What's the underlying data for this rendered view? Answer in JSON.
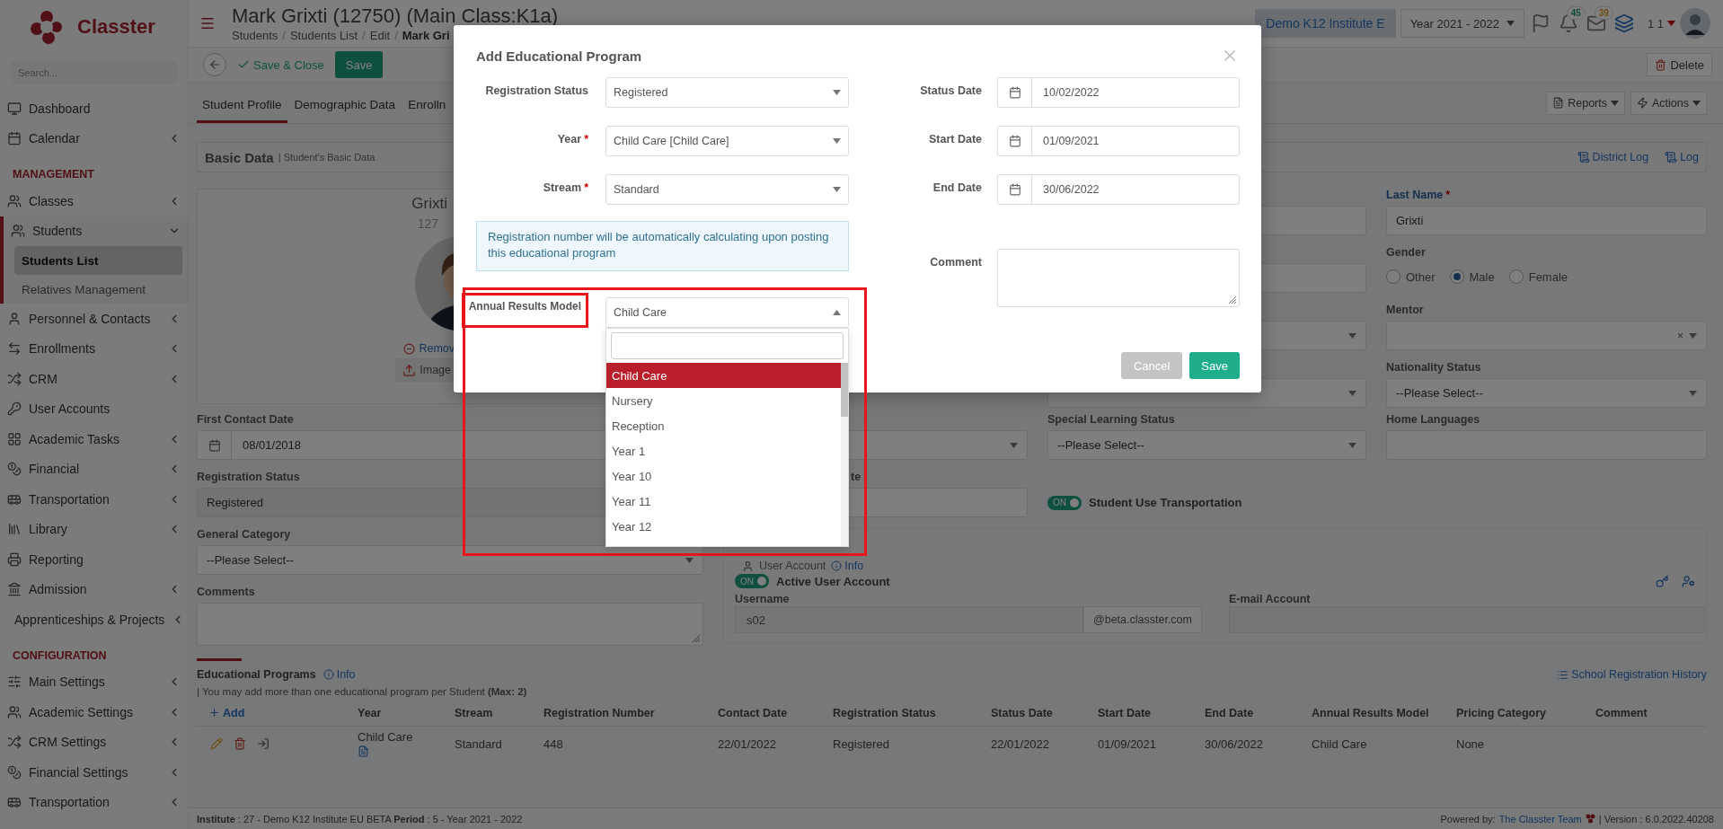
{
  "sidebar": {
    "logo": "Classter",
    "search_placeholder": "Search...",
    "items": [
      {
        "kind": "item",
        "label": "Dashboard",
        "expandable": false,
        "expanded": false
      },
      {
        "kind": "item",
        "label": "Calendar",
        "expandable": true,
        "expanded": false
      },
      {
        "kind": "header",
        "label": "MANAGEMENT"
      },
      {
        "kind": "item",
        "label": "Classes",
        "expandable": true,
        "expanded": false
      },
      {
        "kind": "item",
        "label": "Students",
        "expandable": true,
        "expanded": true,
        "children": [
          {
            "label": "Students List",
            "selected": true
          },
          {
            "label": "Relatives Management",
            "selected": false
          }
        ]
      },
      {
        "kind": "item",
        "label": "Personnel & Contacts",
        "expandable": true,
        "expanded": false
      },
      {
        "kind": "item",
        "label": "Enrollments",
        "expandable": true,
        "expanded": false
      },
      {
        "kind": "item",
        "label": "CRM",
        "expandable": true,
        "expanded": false
      },
      {
        "kind": "item",
        "label": "User Accounts",
        "expandable": false,
        "expanded": false
      },
      {
        "kind": "item",
        "label": "Academic Tasks",
        "expandable": true,
        "expanded": false
      },
      {
        "kind": "item",
        "label": "Financial",
        "expandable": true,
        "expanded": false
      },
      {
        "kind": "item",
        "label": "Transportation",
        "expandable": true,
        "expanded": false
      },
      {
        "kind": "item",
        "label": "Library",
        "expandable": true,
        "expanded": false
      },
      {
        "kind": "item",
        "label": "Reporting",
        "expandable": false,
        "expanded": false
      },
      {
        "kind": "item",
        "label": "Admission",
        "expandable": true,
        "expanded": false
      },
      {
        "kind": "item",
        "label": "Apprenticeships & Projects",
        "expandable": true,
        "expanded": false
      },
      {
        "kind": "header",
        "label": "CONFIGURATION"
      },
      {
        "kind": "item",
        "label": "Main Settings",
        "expandable": true,
        "expanded": false
      },
      {
        "kind": "item",
        "label": "Academic Settings",
        "expandable": true,
        "expanded": false
      },
      {
        "kind": "item",
        "label": "CRM Settings",
        "expandable": true,
        "expanded": false
      },
      {
        "kind": "item",
        "label": "Financial Settings",
        "expandable": true,
        "expanded": false
      },
      {
        "kind": "item",
        "label": "Transportation",
        "expandable": true,
        "expanded": false
      }
    ]
  },
  "header": {
    "title": "Mark Grixti (12750) (Main Class:K1a)",
    "separator": "/",
    "breadcrumb": [
      "Students",
      "Students List",
      "Edit",
      "Mark Gri"
    ],
    "institute": "Demo K12 Institute E",
    "year": "Year 2021 - 2022",
    "notification_count": "45",
    "message_count": "39",
    "user": "1 1"
  },
  "toolbar": {
    "save_close": "Save & Close",
    "save": "Save",
    "delete": "Delete"
  },
  "tabs": [
    {
      "label": "Student Profile",
      "selected": true
    },
    {
      "label": "Demographic Data",
      "selected": false
    },
    {
      "label": "Enrolln",
      "selected": false
    }
  ],
  "tab_actions": {
    "reports": "Reports",
    "actions": "Actions"
  },
  "basic_data": {
    "title": "Basic Data",
    "subtitle": "| Student's Basic Data",
    "district_log": "District Log",
    "log": "Log"
  },
  "profile_card": {
    "name": "Grixti",
    "code": "127",
    "remove": "Remov",
    "image": "Image"
  },
  "left_fields": [
    {
      "kind": "date",
      "label": "First Contact Date",
      "value": "08/01/2018"
    },
    {
      "kind": "readonly",
      "label": "Registration Status",
      "value": "Registered"
    },
    {
      "kind": "select",
      "label": "General Category",
      "value": "--Please Select--"
    },
    {
      "kind": "textarea",
      "label": "Comments"
    }
  ],
  "middle_fields": [
    {
      "kind": "select"
    },
    {
      "kind": "input",
      "label": "te"
    }
  ],
  "center_fields": [
    {
      "kind": "input"
    },
    {
      "kind": "input"
    },
    {
      "kind": "select"
    },
    {
      "kind": "select"
    },
    {
      "kind": "select",
      "label": "Special Learning Status",
      "value": "--Please Select--"
    },
    {
      "kind": "toggle",
      "label": "Student Use Transportation",
      "on": true,
      "on_text": "ON"
    }
  ],
  "right_fields": [
    {
      "kind": "input",
      "label": "Last Name",
      "required_mark": "*",
      "value": "Grixti"
    },
    {
      "kind": "radio",
      "label": "Gender",
      "options": [
        {
          "label": "Other",
          "selected": false
        },
        {
          "label": "Male",
          "selected": true
        },
        {
          "label": "Female",
          "selected": false
        }
      ]
    },
    {
      "kind": "select",
      "label": "Mentor",
      "clear": "×"
    },
    {
      "kind": "select",
      "label": "Nationality Status",
      "value": "--Please Select--"
    },
    {
      "kind": "input",
      "label": "Home Languages"
    }
  ],
  "user_account": {
    "title": "User Account",
    "info": "Info",
    "active": {
      "on": true,
      "on_text": "ON",
      "label": "Active User Account"
    },
    "username_label": "Username",
    "username": "s02",
    "domain": "@beta.classter.com",
    "email_label": "E-mail Account"
  },
  "educational_programs": {
    "title": "Educational Programs",
    "info": "Info",
    "history": "School Registration History",
    "note": "| You may add more than one educational program per Student **(Max: 2)**",
    "add": "Add",
    "columns": [
      "Year",
      "Stream",
      "Registration Number",
      "Contact Date",
      "Registration Status",
      "Status Date",
      "Start Date",
      "End Date",
      "Annual Results Model",
      "Pricing Category",
      "Comment"
    ],
    "rows": [
      {
        "cells": [
          "Child Care",
          "Standard",
          "448",
          "22/01/2022",
          "Registered",
          "22/01/2022",
          "01/09/2021",
          "30/06/2022",
          "Child Care",
          "None"
        ]
      }
    ]
  },
  "footer": {
    "info": "**Institute** : 27 - Demo K12 Institute EU BETA **Period** : 5 - Year 2021 - 2022",
    "powered_by": "Powered by:",
    "team": "The Classter Team",
    "version": "| Version : 6.0.2022.40208"
  },
  "modal": {
    "title": "Add Educational Program",
    "left": [
      {
        "label": "Registration Status",
        "value": "Registered"
      },
      {
        "label": "Year",
        "required_mark": "*",
        "value": "Child Care [Child Care]"
      },
      {
        "label": "Stream",
        "required_mark": "*",
        "value": "Standard"
      }
    ],
    "notice": "Registration number will be automatically calculating upon posting this educational program",
    "annual_results": {
      "label": "Annual Results Model",
      "value": "Child Care",
      "open": true,
      "highlighted": true,
      "options": [
        {
          "label": "Child Care",
          "selected": true
        },
        {
          "label": "Nursery",
          "selected": false
        },
        {
          "label": "Reception",
          "selected": false
        },
        {
          "label": "Year 1",
          "selected": false
        },
        {
          "label": "Year 10",
          "selected": false
        },
        {
          "label": "Year 11",
          "selected": false
        },
        {
          "label": "Year 12",
          "selected": false
        }
      ]
    },
    "right": [
      {
        "label": "Status Date",
        "value": "10/02/2022"
      },
      {
        "label": "Start Date",
        "value": "01/09/2021"
      },
      {
        "label": "End Date",
        "value": "30/06/2022"
      }
    ],
    "comment_label": "Comment",
    "cancel": "Cancel",
    "save": "Save"
  }
}
